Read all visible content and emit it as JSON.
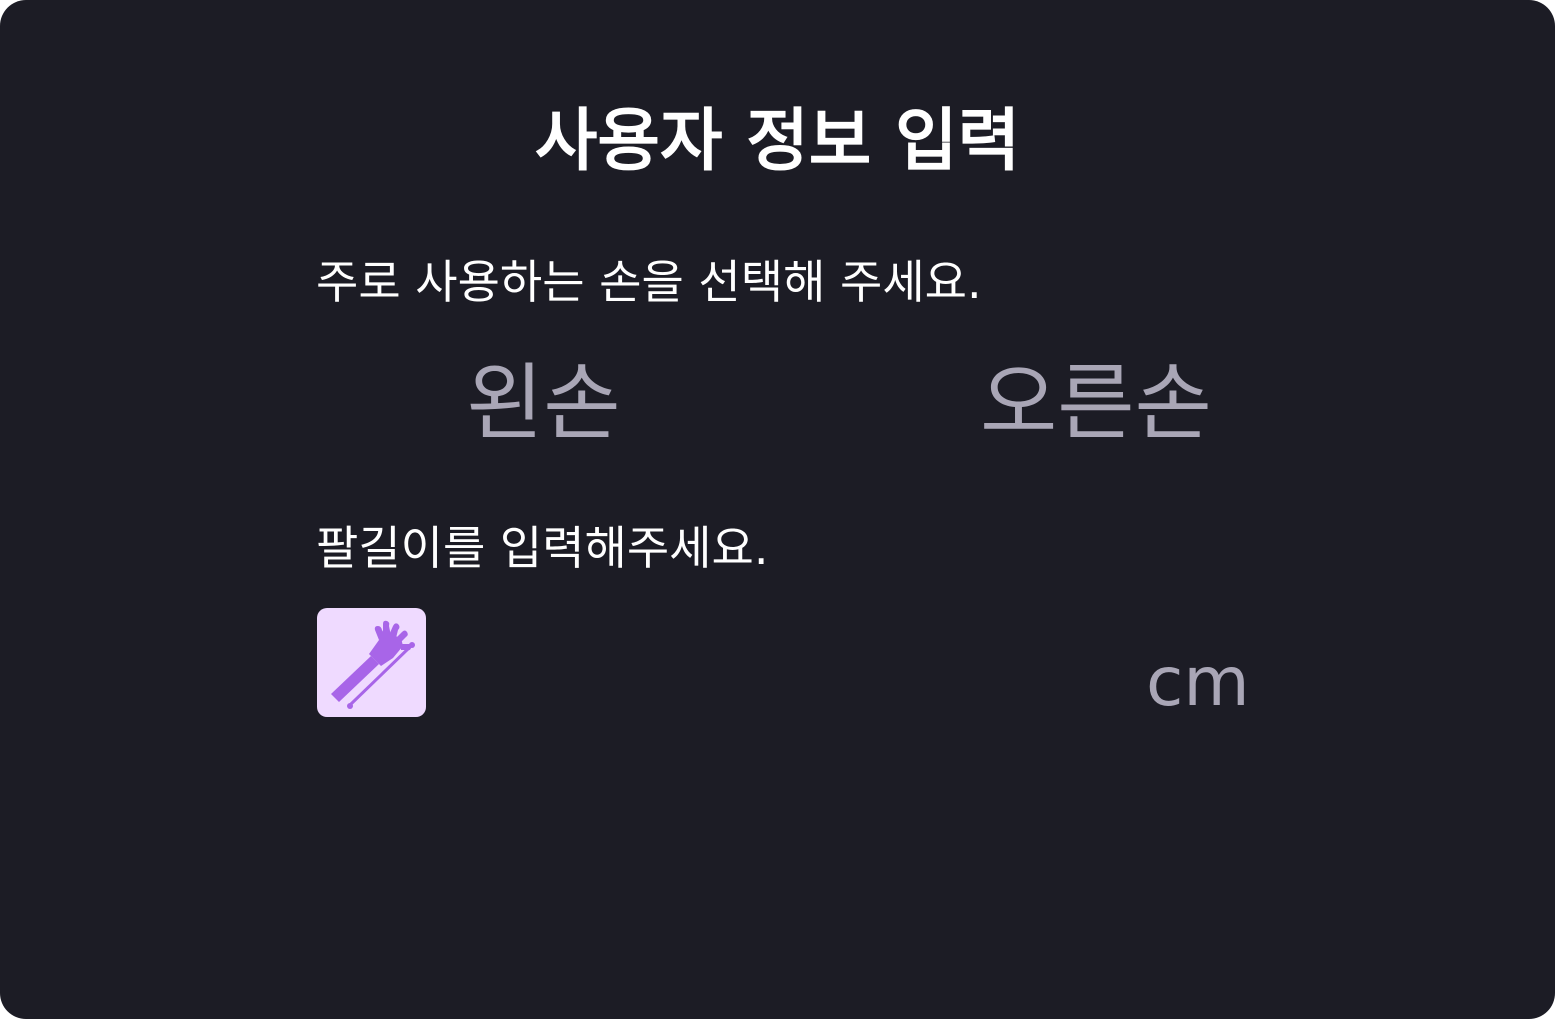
{
  "form": {
    "title": "사용자 정보 입력",
    "hand_question": "주로 사용하는 손을 선택해 주세요.",
    "hand_options": [
      {
        "label": "왼손"
      },
      {
        "label": "오른손"
      }
    ],
    "arm_question": "팔길이를 입력해주세요.",
    "arm_input": {
      "value": "",
      "placeholder": ""
    },
    "arm_unit": "cm",
    "arm_icon": "arm-ruler-icon"
  },
  "colors": {
    "background": "#1c1c25",
    "text": "#ffffff",
    "muted_text": "#a9a6b6",
    "icon_background": "#efdaff",
    "icon_accent": "#a865e8"
  }
}
